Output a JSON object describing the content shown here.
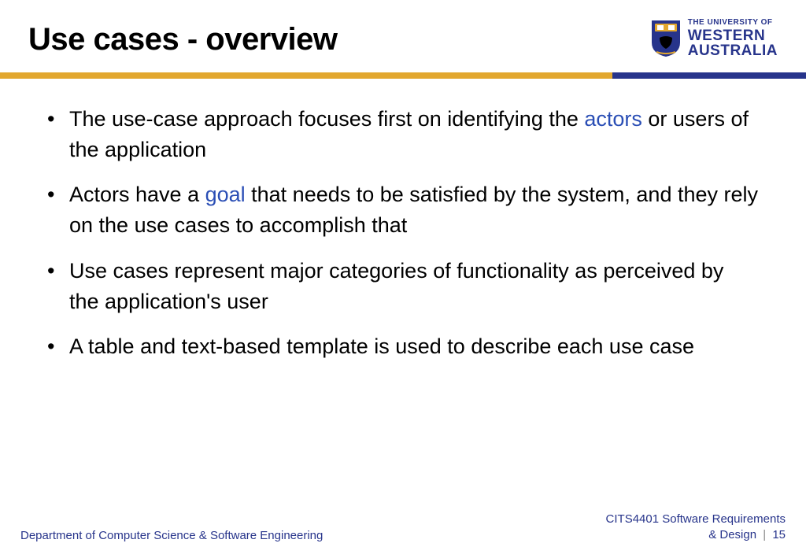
{
  "header": {
    "title": "Use cases - overview",
    "logo": {
      "top_line": "THE UNIVERSITY OF",
      "line2": "WESTERN",
      "line3": "AUSTRALIA"
    }
  },
  "bullets": [
    {
      "pre": "The use-case approach focuses first on identifying the ",
      "hl": "actors",
      "post": " or users of the application"
    },
    {
      "pre": "Actors have a ",
      "hl": "goal",
      "post": " that needs to be satisfied by the system, and they rely on the use cases to accomplish that"
    },
    {
      "pre": "Use cases represent major categories of functionality as perceived by the application's user",
      "hl": "",
      "post": ""
    },
    {
      "pre": "A table and text-based template is used to describe each use case",
      "hl": "",
      "post": ""
    }
  ],
  "footer": {
    "left": "Department of Computer Science & Software Engineering",
    "right_line1": "CITS4401 Software Requirements",
    "right_line2_label": "& Design",
    "separator": "|",
    "page": "15"
  },
  "colors": {
    "gold": "#e2a72e",
    "blue": "#27348b",
    "highlight": "#2a4eb5"
  }
}
